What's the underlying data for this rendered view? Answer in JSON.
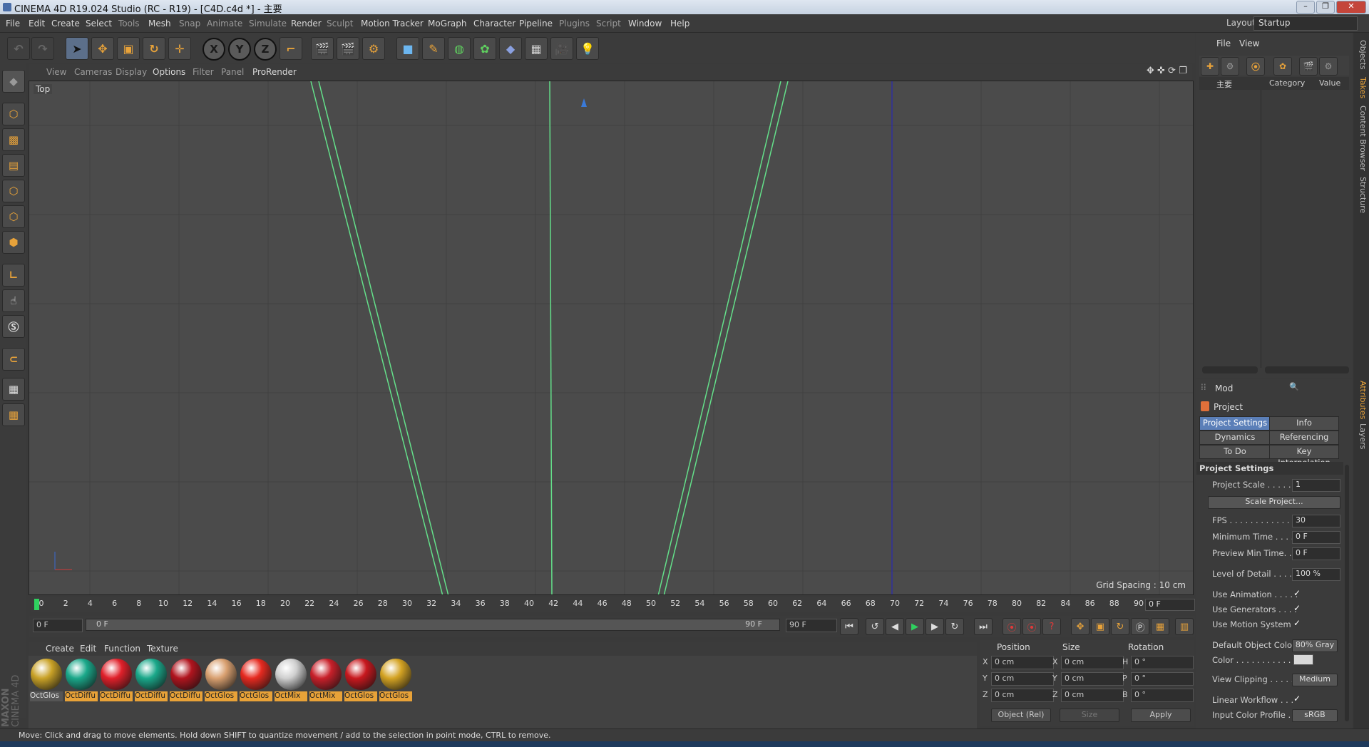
{
  "window": {
    "title": "CINEMA 4D R19.024 Studio (RC - R19) - [C4D.c4d *] - 主要"
  },
  "menubar": {
    "items": [
      "File",
      "Edit",
      "Create",
      "Select",
      "Tools",
      "Mesh",
      "Snap",
      "Animate",
      "Simulate",
      "Render",
      "Sculpt",
      "Motion Tracker",
      "MoGraph",
      "Character",
      "Pipeline",
      "Plugins",
      "Script",
      "Window",
      "Help"
    ],
    "layout_label": "Layout:",
    "layout_value": "Startup"
  },
  "toolbar": {
    "axis_x": "X",
    "axis_y": "Y",
    "axis_z": "Z"
  },
  "viewport": {
    "menu": [
      "View",
      "Cameras",
      "Display",
      "Options",
      "Filter",
      "Panel",
      "ProRender"
    ],
    "view_name": "Top",
    "grid_spacing": "Grid Spacing : 10 cm"
  },
  "timeline": {
    "ticks": [
      "0",
      "2",
      "4",
      "6",
      "8",
      "10",
      "12",
      "14",
      "16",
      "18",
      "20",
      "22",
      "24",
      "26",
      "28",
      "30",
      "32",
      "34",
      "36",
      "38",
      "40",
      "42",
      "44",
      "46",
      "48",
      "50",
      "52",
      "54",
      "56",
      "58",
      "60",
      "62",
      "64",
      "66",
      "68",
      "70",
      "72",
      "74",
      "76",
      "78",
      "80",
      "82",
      "84",
      "86",
      "88",
      "90"
    ],
    "end_field": "0 F",
    "current_frame": "0 F",
    "range_start": "0 F",
    "range_end": "90 F",
    "max_frame": "90 F"
  },
  "materials": {
    "menu": [
      "Create",
      "Edit",
      "Function",
      "Texture"
    ],
    "items": [
      {
        "label": "OctGlos",
        "color": "#c9a227"
      },
      {
        "label": "OctDiffu",
        "color": "#1aa88a"
      },
      {
        "label": "OctDiffu",
        "color": "#e0202a"
      },
      {
        "label": "OctDiffu",
        "color": "#1aa88a"
      },
      {
        "label": "OctDiffu",
        "color": "#b0141e"
      },
      {
        "label": "OctGlos",
        "color": "#d9a070"
      },
      {
        "label": "OctGlos",
        "color": "#e62a20"
      },
      {
        "label": "OctMix",
        "color": "#cfcfcf"
      },
      {
        "label": "OctMix",
        "color": "#c8202a"
      },
      {
        "label": "OctGlos",
        "color": "#c8181e"
      },
      {
        "label": "OctGlos",
        "color": "#d4a323"
      }
    ],
    "logo_top": "MAXON",
    "logo_bottom": "CINEMA 4D"
  },
  "coordinates": {
    "headers": [
      "Position",
      "Size",
      "Rotation"
    ],
    "rows": [
      {
        "axis": "X",
        "pos": "0 cm",
        "size_axis": "X",
        "size": "0 cm",
        "rot_axis": "H",
        "rot": "0 °"
      },
      {
        "axis": "Y",
        "pos": "0 cm",
        "size_axis": "Y",
        "size": "0 cm",
        "rot_axis": "P",
        "rot": "0 °"
      },
      {
        "axis": "Z",
        "pos": "0 cm",
        "size_axis": "Z",
        "size": "0 cm",
        "rot_axis": "B",
        "rot": "0 °"
      }
    ],
    "mode": "Object (Rel)",
    "size_mode": "Size",
    "apply": "Apply"
  },
  "objects": {
    "menu": [
      "File",
      "View"
    ],
    "col_name": "主要",
    "col_category": "Category",
    "col_value": "Value"
  },
  "attributes": {
    "menu": "Mod",
    "object": "Project",
    "tabs": [
      "Project Settings",
      "Info",
      "Dynamics",
      "Referencing",
      "To Do",
      "Key Interpolation"
    ],
    "section": "Project Settings",
    "project_scale_label": "Project Scale . . . . . .",
    "project_scale": "1",
    "scale_project_btn": "Scale Project...",
    "fps_label": "FPS . . . . . . . . . . . . . .",
    "fps": "30",
    "min_time_label": "Minimum Time . . . . .",
    "min_time": "0 F",
    "preview_min_label": "Preview Min Time. . .",
    "preview_min": "0 F",
    "lod_label": "Level of Detail . . . . .",
    "lod": "100 %",
    "use_anim": "Use Animation . . . . .",
    "use_gen": "Use Generators . . . .",
    "use_motion": "Use Motion System",
    "default_color_label": "Default Object Color",
    "default_color": "80% Gray",
    "color_label": "Color . . . . . . . . . . .",
    "view_clip_label": "View Clipping . . . . .",
    "view_clip": "Medium",
    "linear_wf": "Linear Workflow . . .",
    "input_profile_label": "Input Color Profile . .",
    "input_profile": "sRGB",
    "checkmark": "✓"
  },
  "side_tabs": [
    "Objects",
    "Takes",
    "Content Browser",
    "Structure",
    "Attributes",
    "Layers"
  ],
  "status": "Move: Click and drag to move elements. Hold down SHIFT to quantize movement / add to the selection in point mode, CTRL to remove."
}
